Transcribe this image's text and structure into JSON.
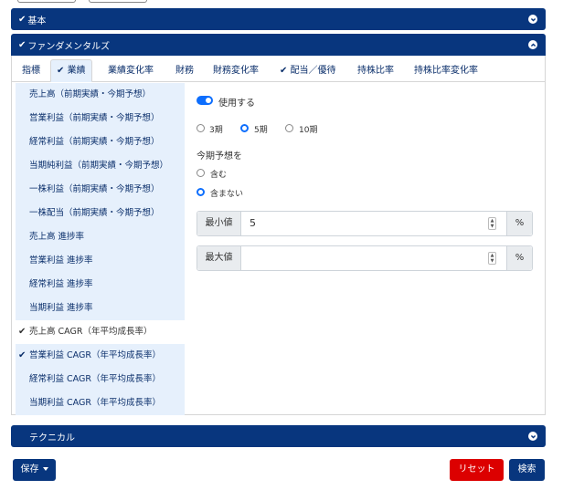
{
  "panels": {
    "basic": {
      "title": "基本",
      "checked": true
    },
    "fundamentals": {
      "title": "ファンダメンタルズ",
      "checked": true
    },
    "technical": {
      "title": "テクニカル",
      "checked": false
    }
  },
  "tabs": [
    {
      "label": "指標",
      "active": false,
      "checked": false
    },
    {
      "label": "業績",
      "active": true,
      "checked": true
    },
    {
      "label": "業績変化率",
      "active": false,
      "checked": false
    },
    {
      "label": "財務",
      "active": false,
      "checked": false
    },
    {
      "label": "財務変化率",
      "active": false,
      "checked": false
    },
    {
      "label": "配当／優待",
      "active": false,
      "checked": true
    },
    {
      "label": "持株比率",
      "active": false,
      "checked": false
    },
    {
      "label": "持株比率変化率",
      "active": false,
      "checked": false
    }
  ],
  "list_items": [
    {
      "label": "売上高（前期実績・今期予想）",
      "checked": false,
      "selected": false
    },
    {
      "label": "営業利益（前期実績・今期予想）",
      "checked": false,
      "selected": false
    },
    {
      "label": "経常利益（前期実績・今期予想）",
      "checked": false,
      "selected": false
    },
    {
      "label": "当期純利益（前期実績・今期予想）",
      "checked": false,
      "selected": false
    },
    {
      "label": "一株利益（前期実績・今期予想）",
      "checked": false,
      "selected": false
    },
    {
      "label": "一株配当（前期実績・今期予想）",
      "checked": false,
      "selected": false
    },
    {
      "label": "売上高 進捗率",
      "checked": false,
      "selected": false
    },
    {
      "label": "営業利益 進捗率",
      "checked": false,
      "selected": false
    },
    {
      "label": "経常利益 進捗率",
      "checked": false,
      "selected": false
    },
    {
      "label": "当期利益 進捗率",
      "checked": false,
      "selected": false
    },
    {
      "label": "売上高 CAGR（年平均成長率）",
      "checked": true,
      "selected": true
    },
    {
      "label": "営業利益 CAGR（年平均成長率）",
      "checked": true,
      "selected": false
    },
    {
      "label": "経常利益 CAGR（年平均成長率）",
      "checked": false,
      "selected": false
    },
    {
      "label": "当期利益 CAGR（年平均成長率）",
      "checked": false,
      "selected": false
    }
  ],
  "detail": {
    "use_label": "使用する",
    "use_enabled": true,
    "period_options": [
      {
        "label": "3期",
        "selected": false
      },
      {
        "label": "5期",
        "selected": true
      },
      {
        "label": "10期",
        "selected": false
      }
    ],
    "forecast_heading": "今期予想を",
    "forecast_options": [
      {
        "label": "含む",
        "selected": false
      },
      {
        "label": "含まない",
        "selected": true
      }
    ],
    "min_label": "最小値",
    "min_value": "5",
    "max_label": "最大値",
    "max_value": "",
    "unit": "%"
  },
  "footer": {
    "save_label": "保存",
    "reset_label": "リセット",
    "search_label": "検索"
  },
  "colors": {
    "navy": "#08367e",
    "list_bg": "#e6f0fc",
    "reset_red": "#dc0000",
    "toggle_blue": "#0d6efd"
  }
}
